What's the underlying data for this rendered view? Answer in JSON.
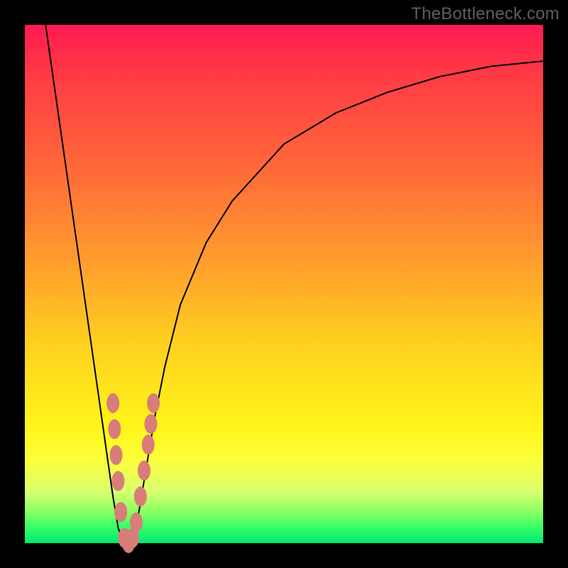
{
  "watermark": "TheBottleneck.com",
  "colors": {
    "gradient_top": "#ff1a50",
    "gradient_mid1": "#ff9b2e",
    "gradient_mid2": "#fff61a",
    "gradient_bottom": "#00e873",
    "curve": "#000000",
    "markers": "#d87d79",
    "frame": "#000000"
  },
  "chart_data": {
    "type": "line",
    "title": "",
    "xlabel": "",
    "ylabel": "",
    "xlim": [
      0,
      100
    ],
    "ylim": [
      0,
      100
    ],
    "grid": false,
    "legend": false,
    "series": [
      {
        "name": "bottleneck-curve",
        "x": [
          4,
          6,
          8,
          10,
          12,
          14,
          16,
          17,
          18,
          19,
          20,
          21,
          22,
          23,
          25,
          27,
          30,
          35,
          40,
          50,
          60,
          70,
          80,
          90,
          100
        ],
        "values": [
          100,
          86,
          72,
          58,
          44,
          30,
          16,
          9,
          3,
          0,
          0,
          2,
          6,
          12,
          24,
          34,
          46,
          58,
          66,
          77,
          83,
          87,
          90,
          92,
          93
        ]
      }
    ],
    "markers": {
      "name": "highlight-points",
      "points": [
        {
          "x": 17.0,
          "y": 27
        },
        {
          "x": 17.3,
          "y": 22
        },
        {
          "x": 17.6,
          "y": 17
        },
        {
          "x": 18.0,
          "y": 12
        },
        {
          "x": 18.5,
          "y": 6
        },
        {
          "x": 19.2,
          "y": 1
        },
        {
          "x": 20.0,
          "y": 0
        },
        {
          "x": 20.8,
          "y": 1
        },
        {
          "x": 21.5,
          "y": 4
        },
        {
          "x": 22.3,
          "y": 9
        },
        {
          "x": 23.0,
          "y": 14
        },
        {
          "x": 23.8,
          "y": 19
        },
        {
          "x": 24.3,
          "y": 23
        },
        {
          "x": 24.8,
          "y": 27
        }
      ]
    }
  }
}
